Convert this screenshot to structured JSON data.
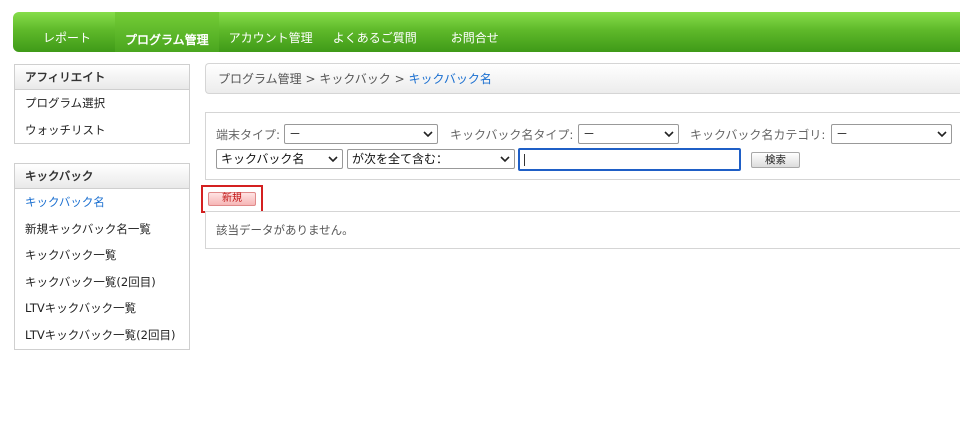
{
  "nav": {
    "items": [
      {
        "label": "レポート"
      },
      {
        "label": "プログラム管理"
      },
      {
        "label": "アカウント管理"
      },
      {
        "label": "よくあるご質問"
      },
      {
        "label": "お問合せ"
      }
    ]
  },
  "sidebar": {
    "affiliate": {
      "title": "アフィリエイト",
      "items": [
        {
          "label": "プログラム選択"
        },
        {
          "label": "ウォッチリスト"
        }
      ]
    },
    "kickback": {
      "title": "キックバック",
      "items": [
        {
          "label": "キックバック名"
        },
        {
          "label": "新規キックバック名一覧"
        },
        {
          "label": "キックバック一覧"
        },
        {
          "label": "キックバック一覧(2回目)"
        },
        {
          "label": "LTVキックバック一覧"
        },
        {
          "label": "LTVキックバック一覧(2回目)"
        }
      ]
    }
  },
  "breadcrumb": {
    "level1": "プログラム管理",
    "sep1": " > ",
    "level2": "キックバック",
    "sep2": " > ",
    "current": "キックバック名"
  },
  "filters": {
    "device_type_label": "端末タイプ:",
    "device_type_value": "－",
    "kickback_name_type_label": "キックバック名タイプ:",
    "kickback_name_type_value": "－",
    "kickback_category_label": "キックバック名カテゴリ:",
    "kickback_category_value": "－",
    "field_value": "キックバック名",
    "match_value": "が次を全て含む："
  },
  "search": {
    "button_label": "検索"
  },
  "actions": {
    "new_label": "新規"
  },
  "result": {
    "empty_message": "該当データがありません。"
  },
  "colors": {
    "nav_green": "#5fb92a",
    "link_blue": "#1a6fd0",
    "highlight_red": "#d42020"
  }
}
